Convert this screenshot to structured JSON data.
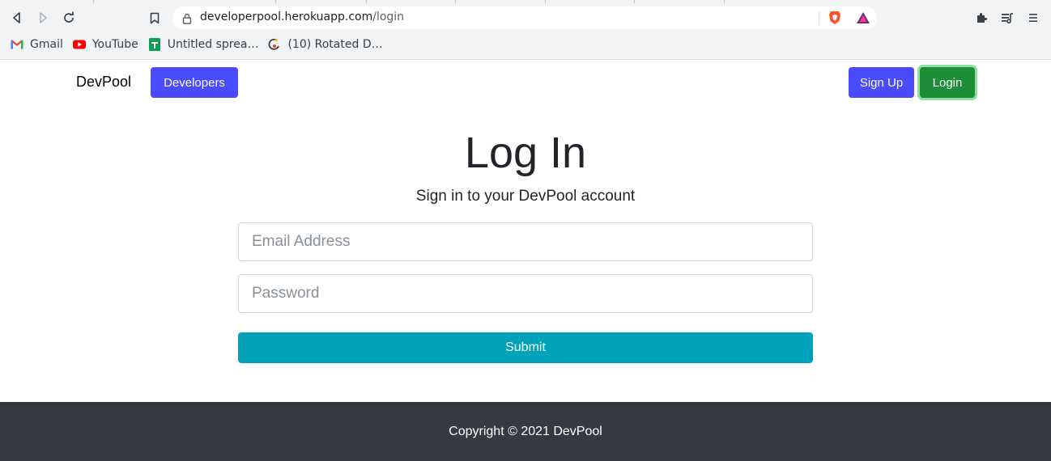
{
  "browser": {
    "url_domain": "developerpool.herokuapp.com",
    "url_path": "/login",
    "bookmarks": [
      {
        "label": "Gmail",
        "icon": "gmail-icon"
      },
      {
        "label": "YouTube",
        "icon": "youtube-icon"
      },
      {
        "label": "Untitled sprea…",
        "icon": "sheets-icon"
      },
      {
        "label": "(10) Rotated D…",
        "icon": "rotated-icon"
      }
    ]
  },
  "nav": {
    "brand": "DevPool",
    "developers": "Developers",
    "signup": "Sign Up",
    "login": "Login"
  },
  "main": {
    "title": "Log In",
    "lead": "Sign in to your DevPool account",
    "email_placeholder": "Email Address",
    "password_placeholder": "Password",
    "submit": "Submit"
  },
  "footer": {
    "copyright": "Copyright © 2021 DevPool"
  },
  "colors": {
    "primary": "#4a4aff",
    "success": "#1e8d37",
    "info": "#00a2b9",
    "footer_bg": "#343a40"
  }
}
